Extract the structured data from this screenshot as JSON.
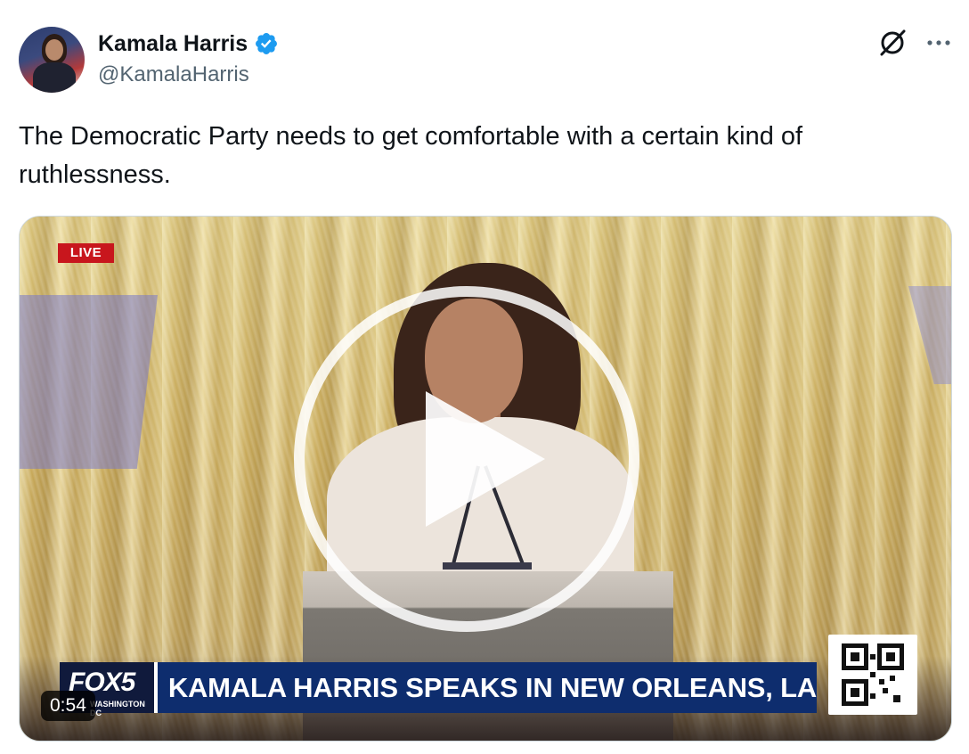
{
  "author": {
    "display_name": "Kamala Harris",
    "handle": "@KamalaHarris",
    "verified": true,
    "verified_color": "#1d9bf0"
  },
  "tweet": {
    "text": "The Democratic Party needs to get comfortable with a certain kind of ruthlessness."
  },
  "video": {
    "live_label": "LIVE",
    "channel_logo": "FOX5",
    "channel_sub": "WASHINGTON DC",
    "headline": "KAMALA HARRIS SPEAKS IN NEW ORLEANS, LA",
    "duration": "0:54"
  },
  "icons": {
    "grok": "grok-icon",
    "more": "more-icon",
    "play": "play-icon",
    "verified": "verified-badge-icon"
  },
  "colors": {
    "text": "#0f1419",
    "secondary_text": "#536471",
    "live_red": "#c8161d",
    "banner_blue": "#0e2d6e"
  }
}
